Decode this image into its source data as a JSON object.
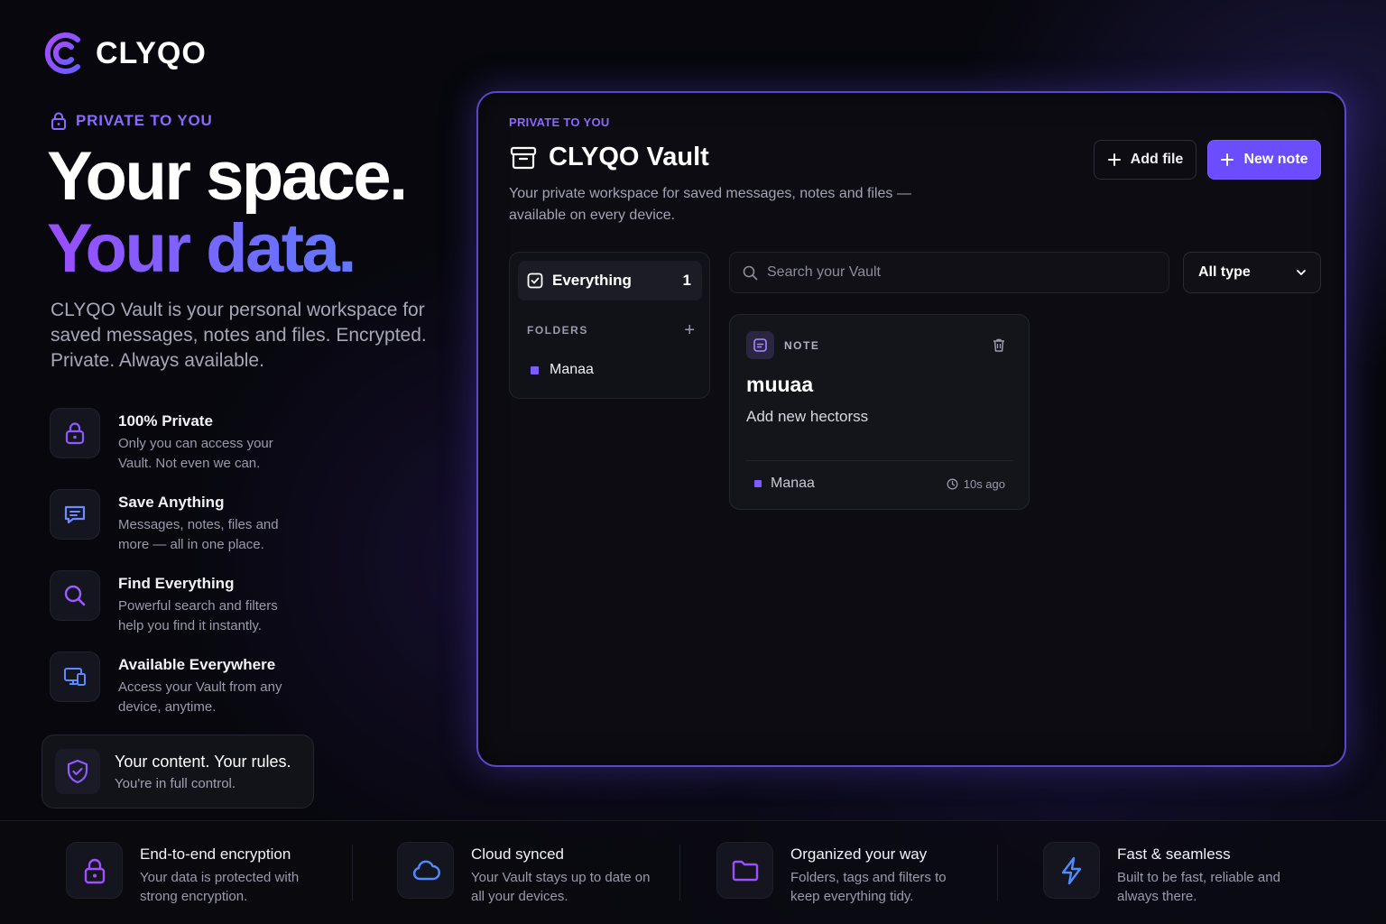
{
  "brand": {
    "name": "CLYQO",
    "accent": "#6b4dff",
    "accent_light": "#8b68ff"
  },
  "hero": {
    "eyebrow": "PRIVATE TO YOU",
    "headline_line1": "Your space.",
    "headline_line2": "Your data.",
    "lead": "CLYQO Vault is your personal workspace for saved messages, notes and files. Encrypted. Private. Always available."
  },
  "features": [
    {
      "icon": "lock-icon",
      "title": "100% Private",
      "desc": "Only you can access your Vault. Not even we can."
    },
    {
      "icon": "message-icon",
      "title": "Save Anything",
      "desc": "Messages, notes, files and more — all in one place."
    },
    {
      "icon": "search-icon",
      "title": "Find Everything",
      "desc": "Powerful search and filters help you find it instantly."
    },
    {
      "icon": "devices-icon",
      "title": "Available Everywhere",
      "desc": "Access your Vault from any device, anytime."
    }
  ],
  "rules_card": {
    "title": "Your content. Your rules.",
    "subtitle": "You're in full control."
  },
  "vault": {
    "eyebrow": "PRIVATE TO YOU",
    "title": "CLYQO Vault",
    "description": "Your private workspace for saved messages, notes and files — available on every device.",
    "add_file_label": "Add file",
    "new_note_label": "New note",
    "sidebar": {
      "everything_label": "Everything",
      "everything_count": "1",
      "folders_header": "FOLDERS",
      "folders": [
        {
          "name": "Manaa"
        }
      ]
    },
    "search": {
      "placeholder": "Search your Vault",
      "value": ""
    },
    "type_filter": {
      "selected": "All type"
    },
    "notes": [
      {
        "type": "NOTE",
        "title": "muuaa",
        "body": "Add new hectorss",
        "folder": "Manaa",
        "time": "10s ago"
      }
    ]
  },
  "bottom_features": [
    {
      "icon": "lock-icon",
      "title": "End-to-end encryption",
      "desc": "Your data is protected with strong encryption."
    },
    {
      "icon": "cloud-icon",
      "title": "Cloud synced",
      "desc": "Your Vault stays up to date on all your devices."
    },
    {
      "icon": "folder-icon",
      "title": "Organized your way",
      "desc": "Folders, tags and filters to keep everything tidy."
    },
    {
      "icon": "lightning-icon",
      "title": "Fast & seamless",
      "desc": "Built to be fast, reliable and always there."
    }
  ]
}
